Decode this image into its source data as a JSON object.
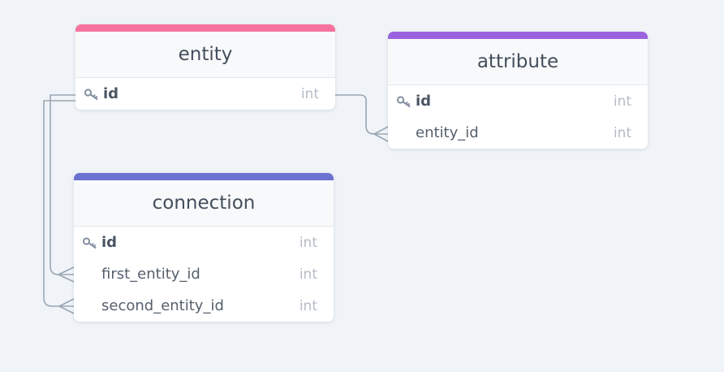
{
  "colors": {
    "background": "#f0f4f8",
    "connector": "#9aa6b4",
    "entity_accent": "#f6739f",
    "attribute_accent": "#9b62e0",
    "connection_accent": "#6b72d0"
  },
  "tables": {
    "entity": {
      "name": "entity",
      "fields": [
        {
          "name": "id",
          "type": "int",
          "primary_key": true
        }
      ]
    },
    "attribute": {
      "name": "attribute",
      "fields": [
        {
          "name": "id",
          "type": "int",
          "primary_key": true
        },
        {
          "name": "entity_id",
          "type": "int",
          "primary_key": false
        }
      ]
    },
    "connection": {
      "name": "connection",
      "fields": [
        {
          "name": "id",
          "type": "int",
          "primary_key": true
        },
        {
          "name": "first_entity_id",
          "type": "int",
          "primary_key": false
        },
        {
          "name": "second_entity_id",
          "type": "int",
          "primary_key": false
        }
      ]
    }
  },
  "relationships": [
    {
      "from": "entity.id",
      "to": "attribute.entity_id",
      "cardinality": "one-to-many"
    },
    {
      "from": "entity.id",
      "to": "connection.first_entity_id",
      "cardinality": "one-to-many"
    },
    {
      "from": "entity.id",
      "to": "connection.second_entity_id",
      "cardinality": "one-to-many"
    }
  ]
}
